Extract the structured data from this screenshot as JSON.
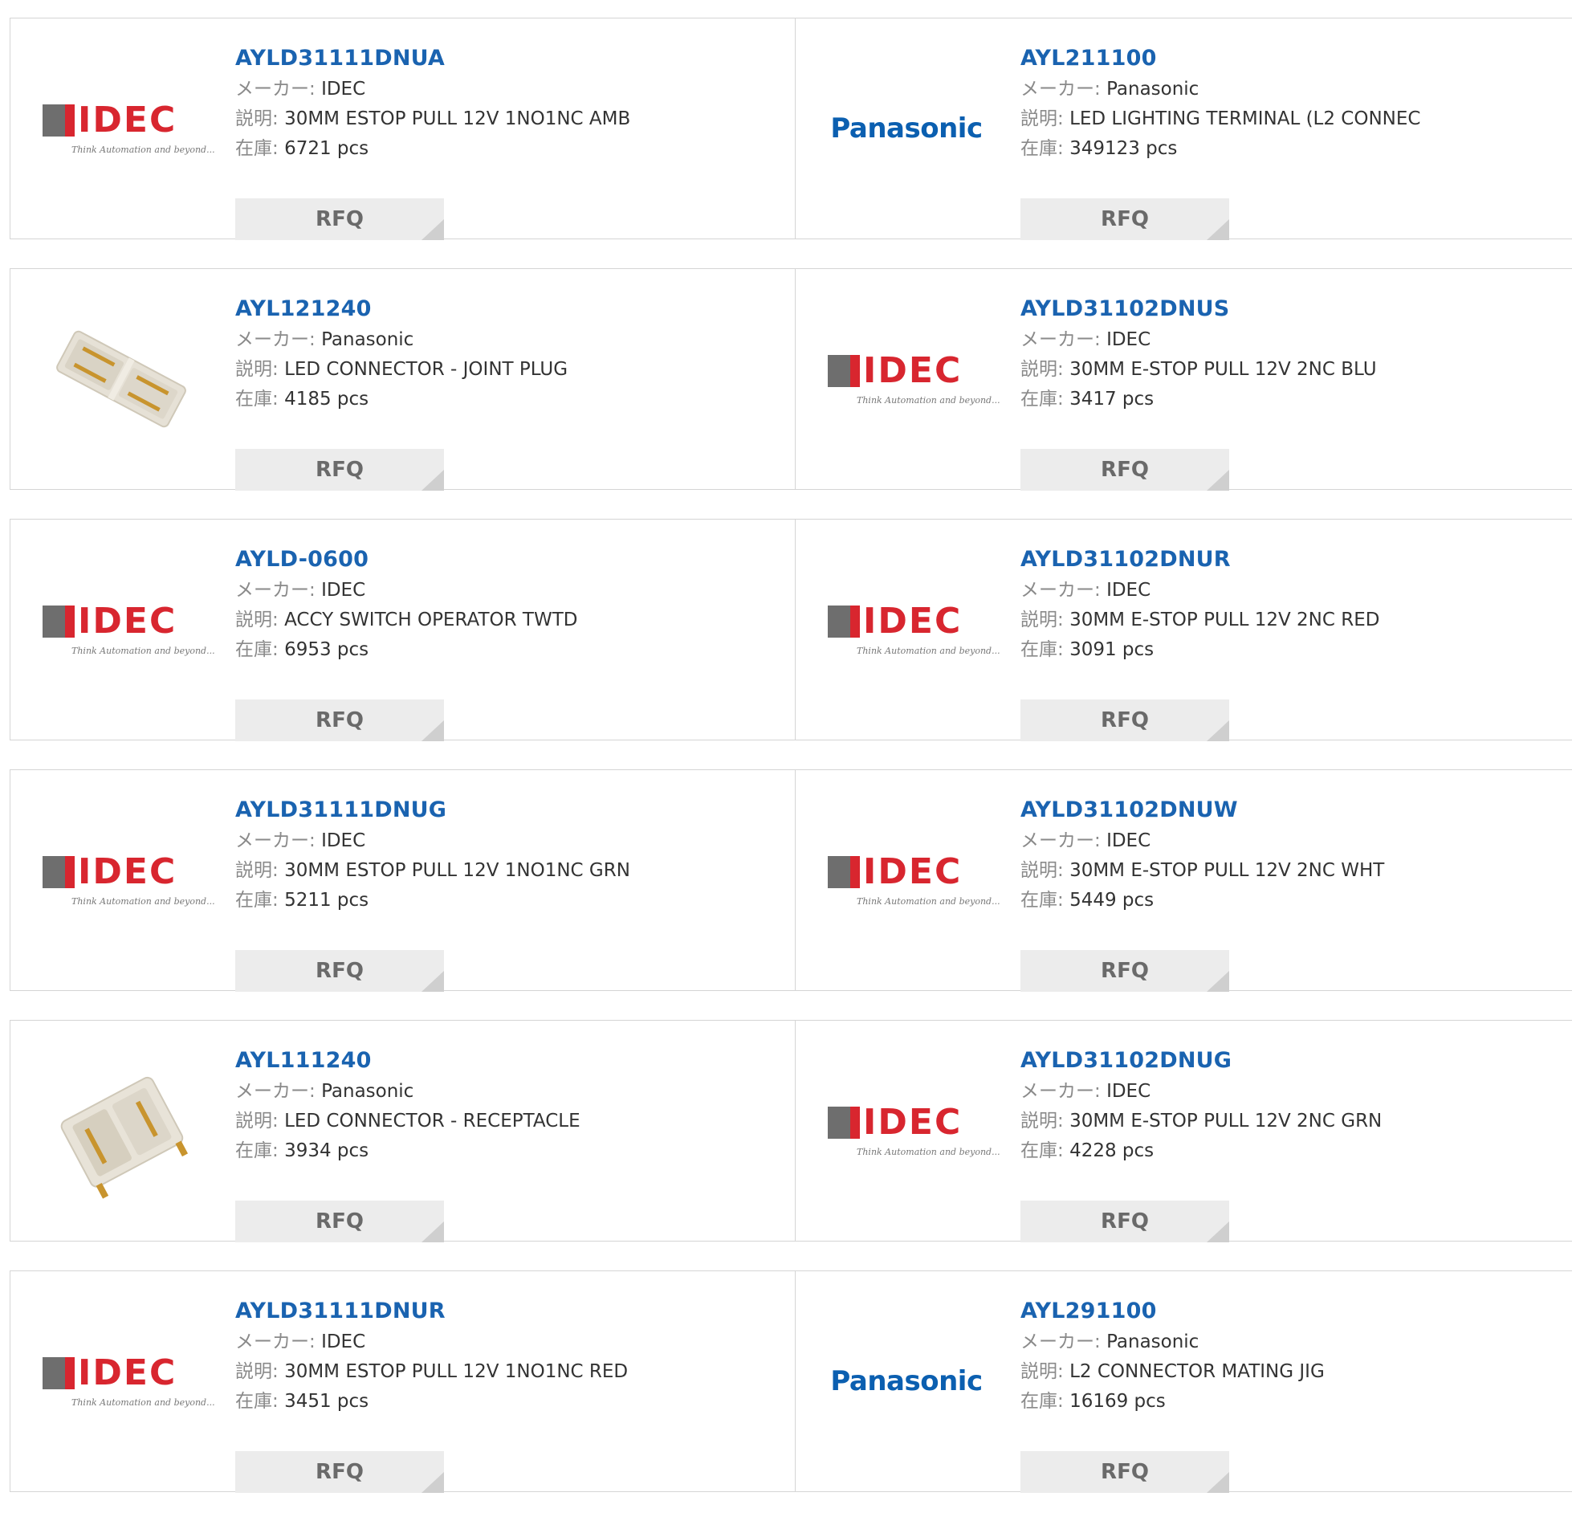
{
  "labels": {
    "maker": "メーカー:",
    "desc": "説明:",
    "stock": "在庫:",
    "rfq": "RFQ"
  },
  "logos": {
    "idec_word": "IDEC",
    "idec_tagline": "Think Automation and beyond...",
    "panasonic_word": "Panasonic"
  },
  "rows": [
    {
      "left": {
        "image": "idec-logo",
        "part": "AYLD31111DNUA",
        "maker": "IDEC",
        "desc": "30MM ESTOP PULL 12V 1NO1NC AMB",
        "stock": "6721 pcs"
      },
      "right": {
        "image": "panasonic-logo",
        "part": "AYL211100",
        "maker": "Panasonic",
        "desc": "LED LIGHTING TERMINAL (L2 CONNEC",
        "stock": "349123 pcs"
      }
    },
    {
      "left": {
        "image": "connector-plug-photo",
        "part": "AYL121240",
        "maker": "Panasonic",
        "desc": "LED CONNECTOR - JOINT PLUG",
        "stock": "4185 pcs"
      },
      "right": {
        "image": "idec-logo",
        "part": "AYLD31102DNUS",
        "maker": "IDEC",
        "desc": "30MM E-STOP PULL 12V 2NC BLU",
        "stock": "3417 pcs"
      }
    },
    {
      "left": {
        "image": "idec-logo",
        "part": "AYLD-0600",
        "maker": "IDEC",
        "desc": "ACCY SWITCH OPERATOR TWTD",
        "stock": "6953 pcs"
      },
      "right": {
        "image": "idec-logo",
        "part": "AYLD31102DNUR",
        "maker": "IDEC",
        "desc": "30MM E-STOP PULL 12V 2NC RED",
        "stock": "3091 pcs"
      }
    },
    {
      "left": {
        "image": "idec-logo",
        "part": "AYLD31111DNUG",
        "maker": "IDEC",
        "desc": "30MM ESTOP PULL 12V 1NO1NC GRN",
        "stock": "5211 pcs"
      },
      "right": {
        "image": "idec-logo",
        "part": "AYLD31102DNUW",
        "maker": "IDEC",
        "desc": "30MM E-STOP PULL 12V 2NC WHT",
        "stock": "5449 pcs"
      }
    },
    {
      "left": {
        "image": "connector-receptacle-photo",
        "part": "AYL111240",
        "maker": "Panasonic",
        "desc": "LED CONNECTOR - RECEPTACLE",
        "stock": "3934 pcs"
      },
      "right": {
        "image": "idec-logo",
        "part": "AYLD31102DNUG",
        "maker": "IDEC",
        "desc": "30MM E-STOP PULL 12V 2NC GRN",
        "stock": "4228 pcs"
      }
    },
    {
      "left": {
        "image": "idec-logo",
        "part": "AYLD31111DNUR",
        "maker": "IDEC",
        "desc": "30MM ESTOP PULL 12V 1NO1NC RED",
        "stock": "3451 pcs"
      },
      "right": {
        "image": "panasonic-logo",
        "part": "AYL291100",
        "maker": "Panasonic",
        "desc": "L2 CONNECTOR MATING JIG",
        "stock": "16169 pcs"
      }
    }
  ],
  "colors": {
    "part_link": "#1a63b0",
    "idec_red": "#d8262f",
    "panasonic_blue": "#0b5fb0",
    "rfq_bg": "#ececec"
  }
}
